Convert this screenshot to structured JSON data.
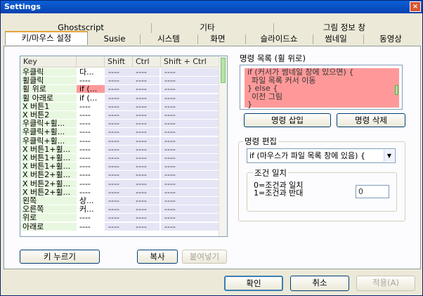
{
  "window": {
    "title": "Settings",
    "close_symbol": "×"
  },
  "tabs": {
    "row1": [
      "Ghostscript",
      "기타",
      "그림 정보 창"
    ],
    "row2": [
      "키/마우스 설정",
      "Susie",
      "시스템",
      "화면",
      "슬라이드쇼",
      "썸네일",
      "동영상"
    ],
    "active": "키/마우스 설정"
  },
  "table": {
    "headers": [
      "Key",
      "",
      "Shift",
      "Ctrl",
      "Shift + Ctrl"
    ],
    "rows": [
      {
        "key": "우클릭",
        "cmd": "다...",
        "highlight": false
      },
      {
        "key": "휠클릭",
        "cmd": "----",
        "highlight": false
      },
      {
        "key": "휠 위로",
        "cmd": "if (...",
        "highlight": true
      },
      {
        "key": "휠 아래로",
        "cmd": "if (...",
        "highlight": false
      },
      {
        "key": "X 버튼1",
        "cmd": "----",
        "highlight": false
      },
      {
        "key": "X 버튼2",
        "cmd": "----",
        "highlight": false
      },
      {
        "key": "우클릭+휠...",
        "cmd": "----",
        "highlight": false
      },
      {
        "key": "우클릭+휠...",
        "cmd": "----",
        "highlight": false
      },
      {
        "key": "우클릭+휠...",
        "cmd": "----",
        "highlight": false
      },
      {
        "key": "X 버튼1+휠...",
        "cmd": "----",
        "highlight": false
      },
      {
        "key": "X 버튼1+휠...",
        "cmd": "----",
        "highlight": false
      },
      {
        "key": "X 버튼1+휠...",
        "cmd": "----",
        "highlight": false
      },
      {
        "key": "X 버튼2+휠...",
        "cmd": "----",
        "highlight": false
      },
      {
        "key": "X 버튼2+휠...",
        "cmd": "----",
        "highlight": false
      },
      {
        "key": "X 버튼2+휠...",
        "cmd": "----",
        "highlight": false
      },
      {
        "key": "왼쪽",
        "cmd": "상...",
        "highlight": false
      },
      {
        "key": "오른쪽",
        "cmd": "커...",
        "highlight": false
      },
      {
        "key": "위로",
        "cmd": "----",
        "highlight": false
      },
      {
        "key": "아래로",
        "cmd": "----",
        "highlight": false
      }
    ],
    "dash": "----"
  },
  "left_buttons": {
    "press_key": "키 누르기",
    "copy": "복사",
    "paste": "붙여넣기"
  },
  "command_list": {
    "title": "명령 목록 (휠 위로)",
    "lines": [
      "if (커서가 썸네일 창에 있으면) {",
      "  파일 목록 커서 이동",
      "} else {",
      "  이전 그림",
      "}"
    ]
  },
  "command_buttons": {
    "insert": "명령 삽입",
    "delete": "명령 삭제"
  },
  "command_edit": {
    "title": "명령 편집",
    "combo_value": "if (마우스가 파일 목록 창에 있음) {",
    "condition": {
      "title": "조건 일치",
      "desc_line1": "0=조건과 일치",
      "desc_line2": "1=조건과 반대",
      "value": "0"
    }
  },
  "dialog_buttons": {
    "ok": "확인",
    "cancel": "취소",
    "apply": "적용(A)"
  }
}
